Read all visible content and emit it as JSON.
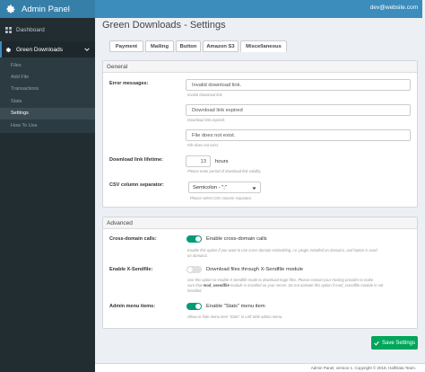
{
  "brand": {
    "title": "Admin Panel"
  },
  "sidebar": {
    "dashboard": "Dashboard",
    "section": "Green Downloads",
    "sub_items": [
      "Files",
      "Add File",
      "Transactions",
      "Stats",
      "Settings",
      "How To Use"
    ]
  },
  "topbar": {
    "user_email": "dev@website.com"
  },
  "page": {
    "title": "Green Downloads - Settings"
  },
  "tabs": [
    "Payment",
    "Mailing",
    "Button",
    "Amazon S3",
    "Miscellaneous"
  ],
  "general": {
    "heading": "General",
    "error_label": "Error messages:",
    "invalid_value": "Invalid download link.",
    "invalid_help": "Invalid download link.",
    "expired_value": "Download link expired",
    "expired_help": "Download link expired.",
    "notexist_value": "File does not exist.",
    "notexist_help": "File does not exist.",
    "lifetime_label": "Download link lifetime:",
    "lifetime_value": "13",
    "lifetime_unit": "hours",
    "lifetime_help": "Please enter period of download link validity.",
    "csv_label": "CSV column separator:",
    "csv_value": "Semicolon - \";\"",
    "csv_help": "Please select CSV column separator."
  },
  "advanced": {
    "heading": "Advanced",
    "cors_label": "Cross-domain calls:",
    "cors_text": "Enable cross-domain calls",
    "cors_help_1": "Enable this option if you want to use cross-domain embedding, i.e. plugin installed on domain1, and button is used",
    "cors_help_2": "on domain2.",
    "xsend_label": "Enable X-Sendfile:",
    "xsend_text": "Download files through X-Sendfile module",
    "xsend_help_1": "Use this option to enable X-Sendfile mode to download huge files. Please contact your hosting provider to make",
    "xsend_help_2a": "sure that",
    "xsend_help_mod": "mod_xsendfile",
    "xsend_help_2b": "module is installed on your server. Do not activate this option if mod_xsendfile module is not",
    "xsend_help_3": "installed.",
    "menu_label": "Admin menu items:",
    "menu_text": "Enable \"Stats\" menu item",
    "menu_help": "Show or hide menu item \"Stats\" in Left Side admin menu."
  },
  "actions": {
    "save": "Save Settings"
  },
  "footer": {
    "text": "Admin Panel, version 1. Copyright © 2019, HalfData Team."
  },
  "colors": {
    "sidebar": "#222d32",
    "brand": "#367fa9",
    "topbar": "#3c8dbc",
    "accent": "#00a65a",
    "toggle_on": "#009b77"
  }
}
